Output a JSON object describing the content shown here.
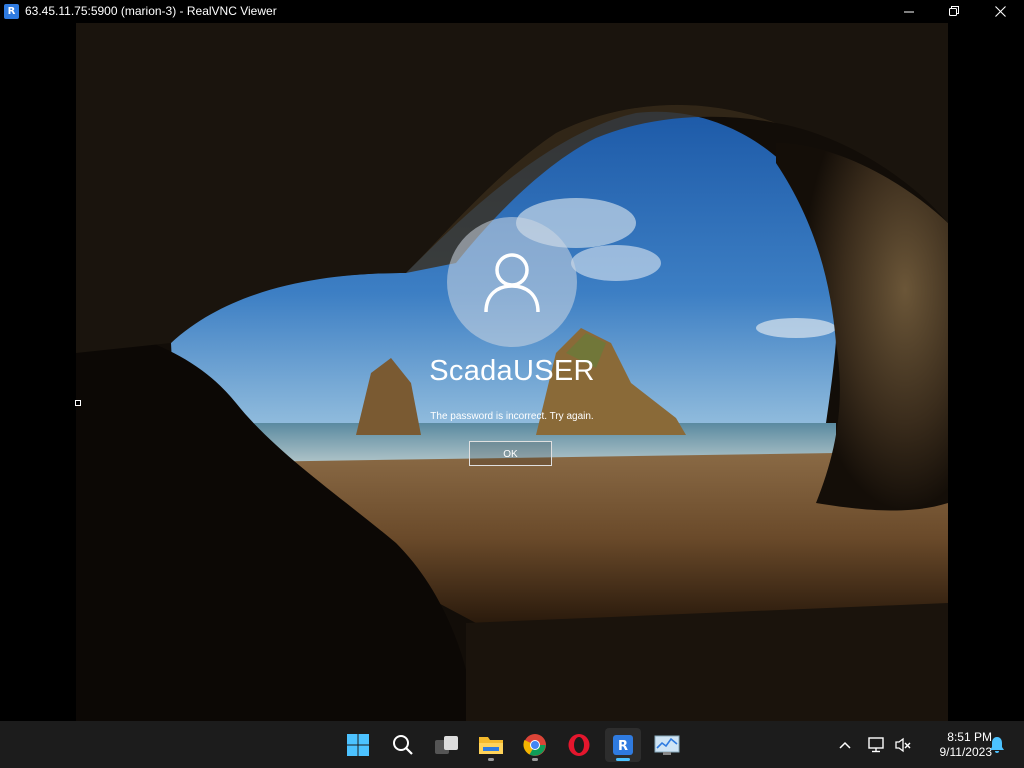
{
  "window": {
    "title": "63.45.11.75:5900 (marion-3) - RealVNC Viewer",
    "app_icon": "realvnc-icon",
    "controls": [
      "minimize-icon",
      "restore-icon",
      "close-icon"
    ]
  },
  "lockscreen": {
    "username": "ScadaUSER",
    "message": "The password is incorrect.  Try again.",
    "ok_label": "OK",
    "avatar_icon": "user-icon"
  },
  "taskbar": {
    "apps": [
      {
        "name": "start-icon"
      },
      {
        "name": "search-icon"
      },
      {
        "name": "task-view-icon"
      },
      {
        "name": "file-explorer-icon"
      },
      {
        "name": "chrome-icon"
      },
      {
        "name": "opera-icon"
      },
      {
        "name": "realvnc-viewer-icon"
      },
      {
        "name": "performance-monitor-icon"
      }
    ],
    "tray": {
      "icons": [
        "chevron-up-icon",
        "network-icon",
        "volume-muted-icon",
        "notification-bell-icon"
      ],
      "time": "8:51 PM",
      "date": "9/11/2023"
    }
  },
  "colors": {
    "accent": "#4cc2ff",
    "taskbar_bg": "#1c1c1c",
    "titlebar_bg": "#000000"
  }
}
